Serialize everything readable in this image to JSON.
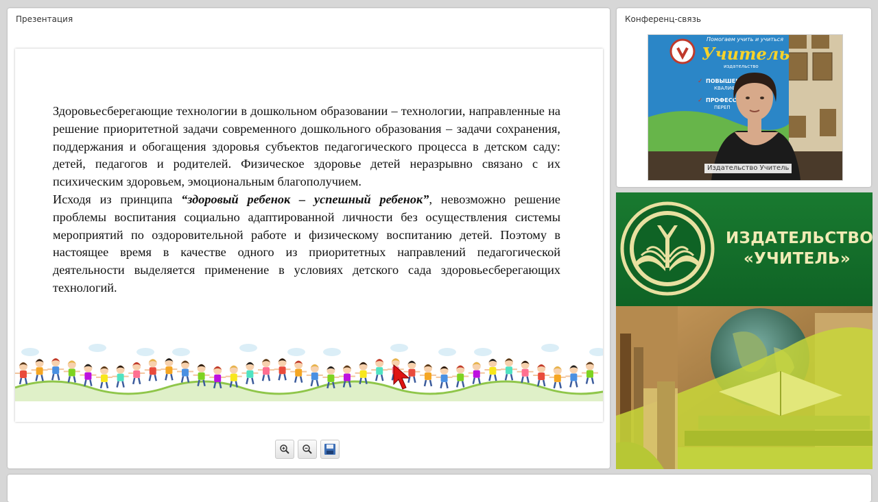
{
  "presentation": {
    "title": "Презентация",
    "slide": {
      "paragraph1": "Здоровьесберегающие технологии в дошкольном образовании – технологии, направленные на решение приоритетной задачи современного дошкольного образования – задачи сохранения, поддержания и обогащения здоровья субъектов педагогического процесса в детском саду: детей, педагогов и родителей. Физическое здоровье детей неразрывно связано с их психическим здоровьем, эмоциональным благополучием.",
      "paragraph2_lead": "Исходя из принципа ",
      "paragraph2_emphasis": "“здоровый ребенок – успешный ребенок”",
      "paragraph2_rest": ", невозможно решение проблемы воспитания социально адаптированной личности без осуществления системы мероприятий по оздоровительной работе и физическому воспитанию детей. Поэтому в настоящее время в качестве одного из приоритетных направлений педагогической деятельности выделяется применение в условиях детского сада здоровьесберегающих технологий."
    },
    "toolbar": {
      "zoom_in_icon": "zoom-in-icon",
      "zoom_out_icon": "zoom-out-icon",
      "save_icon": "save-icon"
    }
  },
  "conference": {
    "title": "Конференц-связь",
    "video_label": "Издательство Учитель",
    "backdrop_text": {
      "tagline": "Помогаем учить и учиться",
      "brand": "Учитель",
      "brand_sub": "издательство",
      "line1": "ПОВЫШЕНИЕ",
      "line1b": "КВАЛИФ",
      "line2": "ПРОФЕСС",
      "line2b": "ПЕРЕП"
    }
  },
  "banner": {
    "line1": "ИЗДАТЕЛЬСТВО",
    "line2": "«УЧИТЕЛЬ»"
  },
  "colors": {
    "banner_green": "#12692a",
    "banner_text": "#f1ebb5",
    "cursor_red": "#e01414"
  }
}
